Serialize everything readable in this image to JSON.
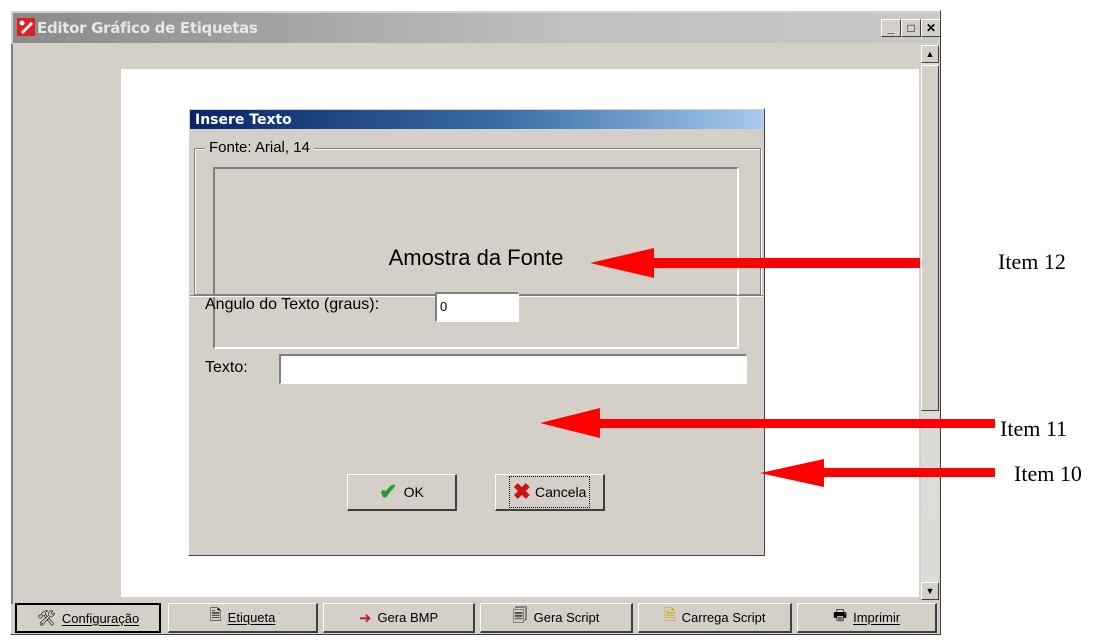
{
  "window": {
    "title": "Editor Gráfico de Etiquetas"
  },
  "toolbar": {
    "buttons": [
      {
        "label": "Configuração",
        "icon": "tools-icon"
      },
      {
        "label": "Etiqueta",
        "icon": "document-icon"
      },
      {
        "label": "Gera BMP",
        "icon": "export-bmp-icon"
      },
      {
        "label": "Gera Script",
        "icon": "generate-script-icon"
      },
      {
        "label": "Carrega Script",
        "icon": "load-script-icon"
      },
      {
        "label": "Imprimir",
        "icon": "printer-icon"
      }
    ]
  },
  "dialog": {
    "title": "Insere Texto",
    "font_group_label": "Fonte: Arial, 14",
    "sample_text": "Amostra da Fonte",
    "angle_label": "Angulo do Texto (graus):",
    "angle_value": "0",
    "text_label": "Texto:",
    "text_value": "",
    "ok_label": "OK",
    "cancel_label": "Cancela"
  },
  "annotations": {
    "item12": "Item 12",
    "item11": "Item 11",
    "item10": "Item 10",
    "arrow_color": "#ff0000"
  }
}
